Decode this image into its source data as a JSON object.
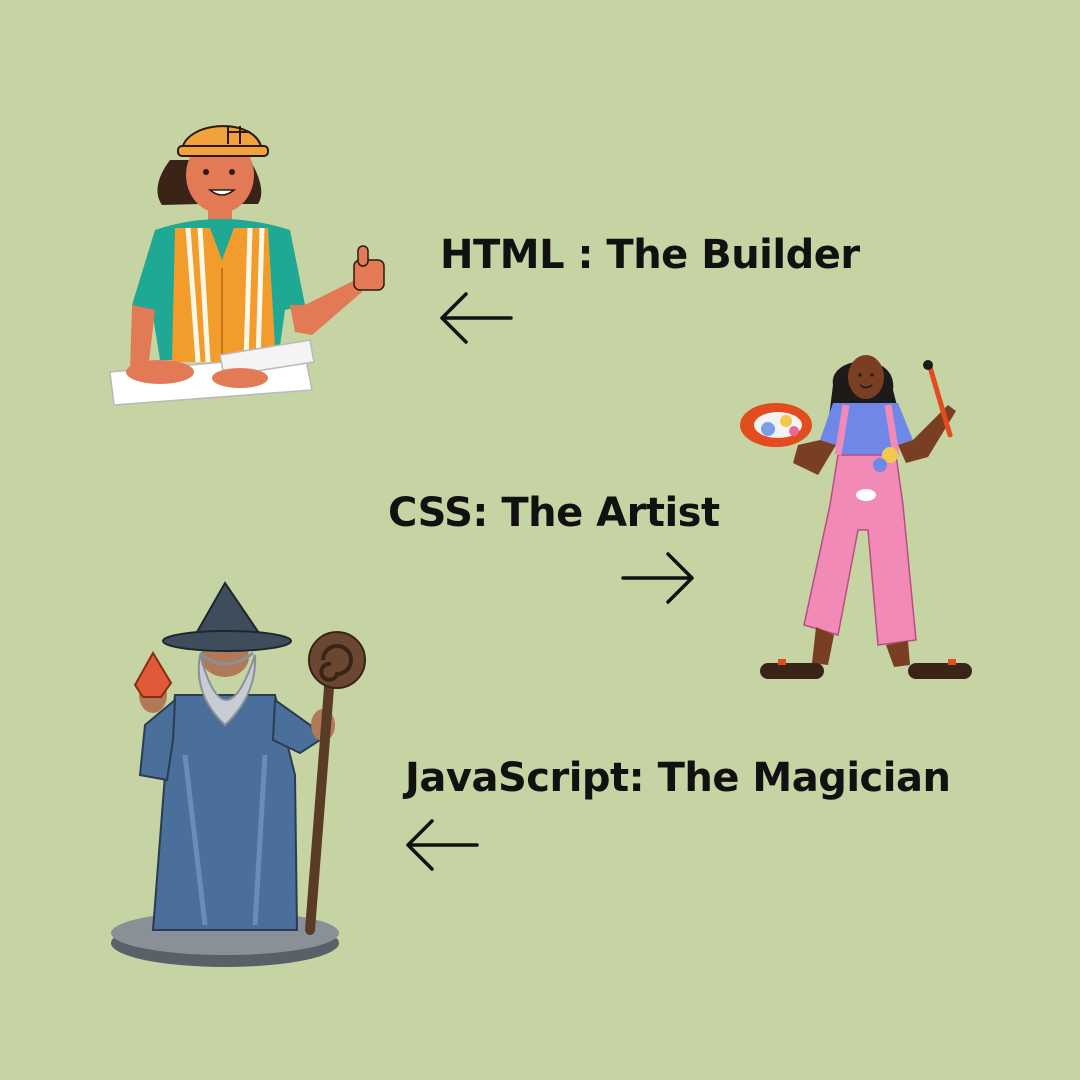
{
  "colors": {
    "background": "#c6d3a2",
    "text": "#111111"
  },
  "roles": [
    {
      "key": "html",
      "label": "HTML : The Builder",
      "arrow_direction": "left",
      "illustration": "construction-worker-illustration"
    },
    {
      "key": "css",
      "label": "CSS: The Artist",
      "arrow_direction": "right",
      "illustration": "painter-illustration"
    },
    {
      "key": "js",
      "label": "JavaScript: The Magician",
      "arrow_direction": "left",
      "illustration": "wizard-illustration"
    }
  ]
}
